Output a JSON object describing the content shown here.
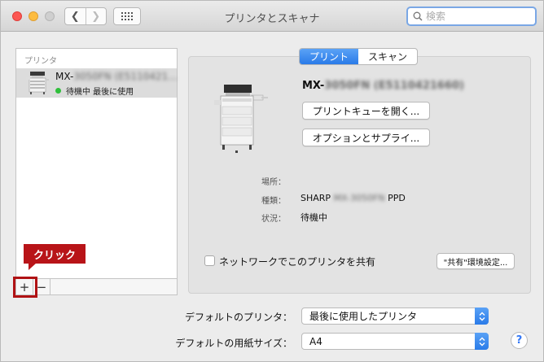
{
  "window": {
    "title": "プリンタとスキャナ",
    "search_placeholder": "検索"
  },
  "printer_list": {
    "header": "プリンタ",
    "items": [
      {
        "name_prefix": "MX-",
        "name_blurred": "3050FN (E5110421...",
        "status": "待機中 最後に使用",
        "status_color": "#2fbf3b"
      }
    ],
    "add_label": "+",
    "remove_label": "−"
  },
  "annotation": {
    "callout": "クリック",
    "color": "#b81418"
  },
  "detail": {
    "tabs": [
      {
        "label": "プリント",
        "active": true
      },
      {
        "label": "スキャン",
        "active": false
      }
    ],
    "model_prefix": "MX-",
    "model_blurred": "3050FN (E5110421660)",
    "queue_button": "プリントキューを開く...",
    "supply_button": "オプションとサプライ...",
    "location_label": "場所：",
    "location_value": "",
    "kind_label": "種類：",
    "kind_prefix": "SHARP",
    "kind_blurred": "MX-3050FN",
    "kind_suffix": "PPD",
    "state_label": "状況：",
    "state_value": "待機中",
    "share_label": "ネットワークでこのプリンタを共有",
    "share_checked": false,
    "share_settings_button": "\"共有\"環境設定..."
  },
  "settings": {
    "default_printer_label": "デフォルトのプリンタ：",
    "default_printer_value": "最後に使用したプリンタ",
    "default_paper_label": "デフォルトの用紙サイズ：",
    "default_paper_value": "A4",
    "help_label": "?"
  },
  "colors": {
    "accent": "#2a7be8",
    "window_bg": "#ececec"
  }
}
